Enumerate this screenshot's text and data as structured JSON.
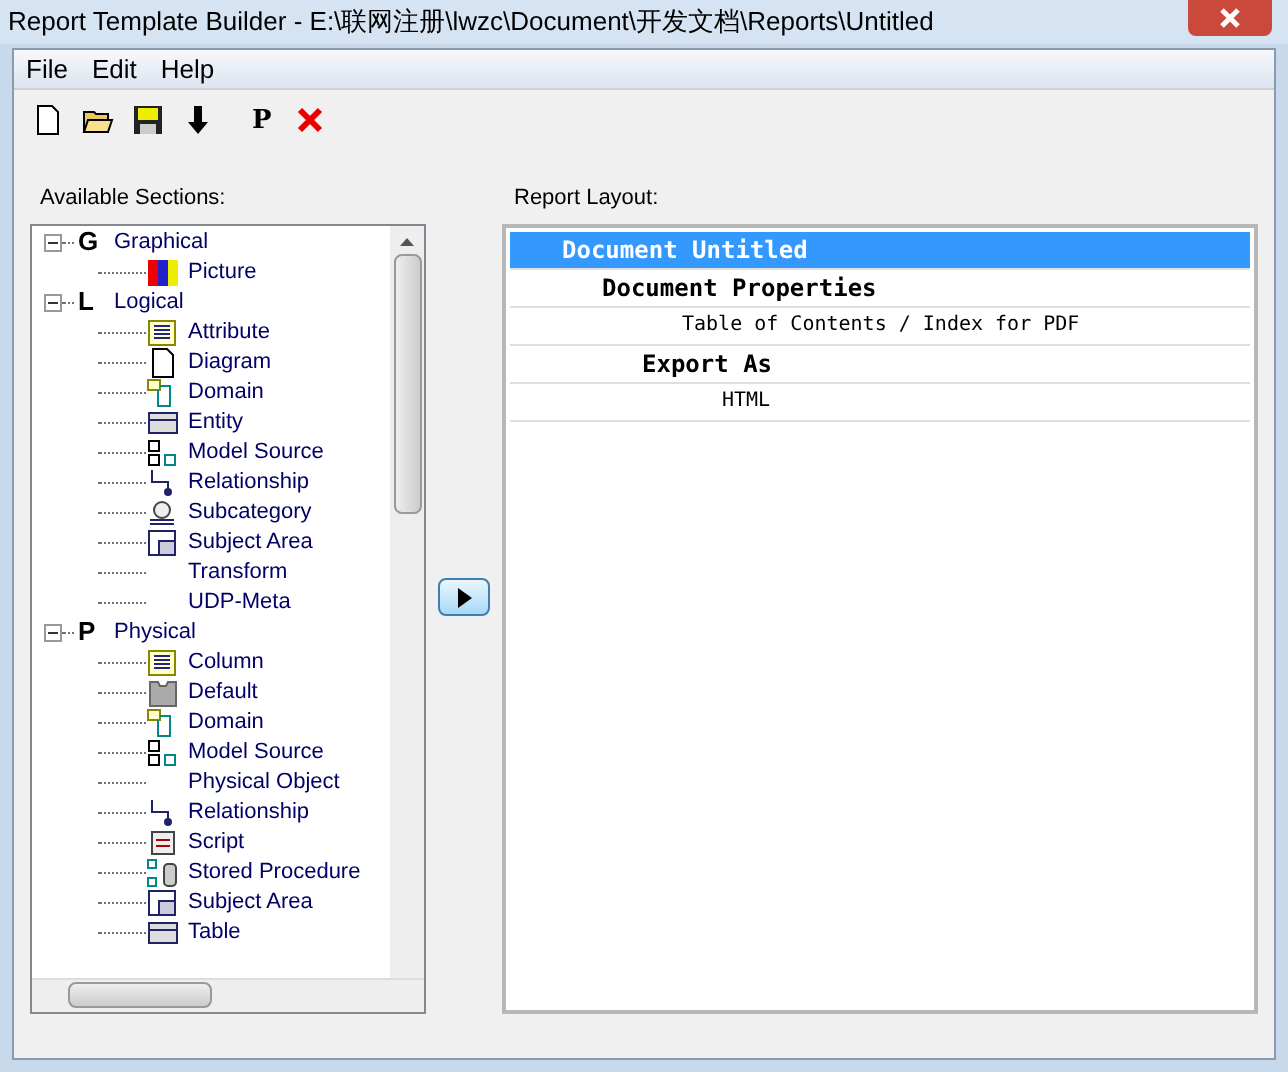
{
  "window": {
    "title": "Report Template Builder - E:\\联网注册\\lwzc\\Document\\开发文档\\Reports\\Untitled"
  },
  "menu": [
    "File",
    "Edit",
    "Help"
  ],
  "toolbar": [
    {
      "kind": "new"
    },
    {
      "kind": "open"
    },
    {
      "kind": "save"
    },
    {
      "kind": "down"
    },
    {
      "kind": "text",
      "label": "P"
    },
    {
      "kind": "delete"
    }
  ],
  "available_sections": {
    "label": "Available Sections:",
    "tree": [
      {
        "letter": "G",
        "label": "Graphical",
        "expanded": true,
        "children": [
          {
            "label": "Picture",
            "kind": "picture"
          }
        ]
      },
      {
        "letter": "L",
        "label": "Logical",
        "expanded": true,
        "children": [
          {
            "label": "Attribute",
            "kind": "list"
          },
          {
            "label": "Diagram",
            "kind": "page"
          },
          {
            "label": "Domain",
            "kind": "domain"
          },
          {
            "label": "Entity",
            "kind": "entity"
          },
          {
            "label": "Model Source",
            "kind": "model"
          },
          {
            "label": "Relationship",
            "kind": "relation"
          },
          {
            "label": "Subcategory",
            "kind": "subcategory"
          },
          {
            "label": "Subject Area",
            "kind": "area"
          },
          {
            "label": "Transform",
            "kind": "none"
          },
          {
            "label": "UDP-Meta",
            "kind": "none"
          }
        ]
      },
      {
        "letter": "P",
        "label": "Physical",
        "expanded": true,
        "children": [
          {
            "label": "Column",
            "kind": "list"
          },
          {
            "label": "Default",
            "kind": "default"
          },
          {
            "label": "Domain",
            "kind": "domain"
          },
          {
            "label": "Model Source",
            "kind": "model"
          },
          {
            "label": "Physical Object",
            "kind": "none"
          },
          {
            "label": "Relationship",
            "kind": "relation"
          },
          {
            "label": "Script",
            "kind": "script"
          },
          {
            "label": "Stored Procedure",
            "kind": "procedure"
          },
          {
            "label": "Subject Area",
            "kind": "area"
          },
          {
            "label": "Table",
            "kind": "entity"
          }
        ]
      }
    ]
  },
  "report_layout": {
    "label": "Report Layout:",
    "rows": [
      {
        "label": "Document Untitled",
        "selected": true,
        "children": [
          {
            "label": "Document Properties",
            "selected": false,
            "children": [
              {
                "label": "Table of Contents / Index for PDF",
                "selected": false
              },
              {
                "label": "Export As",
                "selected": false,
                "children": [
                  {
                    "label": "HTML",
                    "selected": false
                  }
                ]
              }
            ]
          }
        ]
      }
    ]
  }
}
